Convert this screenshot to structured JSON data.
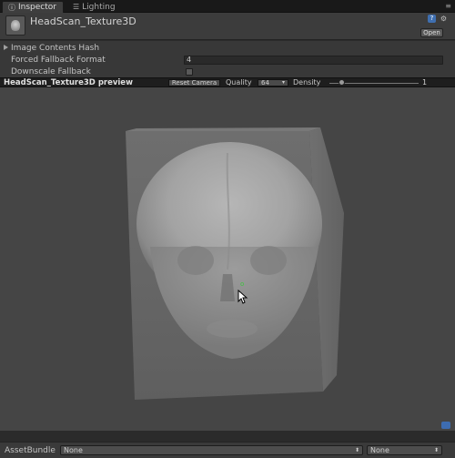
{
  "tabs": [
    {
      "label": "Inspector",
      "icon": "info-icon"
    },
    {
      "label": "Lighting",
      "icon": "lighting-icon"
    }
  ],
  "header": {
    "title": "HeadScan_Texture3D",
    "open_label": "Open"
  },
  "properties": [
    {
      "label": "Image Contents Hash",
      "type": "foldout"
    },
    {
      "label": "Forced Fallback Format",
      "value": "4"
    },
    {
      "label": "Downscale Fallback",
      "checked": false
    }
  ],
  "preview": {
    "title": "HeadScan_Texture3D preview",
    "reset_camera_label": "Reset Camera",
    "quality_label": "Quality",
    "quality_value": "64",
    "density_label": "Density",
    "density_value": "1",
    "gizmo_label": "o"
  },
  "footer": {
    "assetbundle_label": "AssetBundle",
    "bundle_name": "None",
    "variant_name": "None"
  },
  "colors": {
    "background": "#454545",
    "accent": "#3d6cb0",
    "gizmo": "#3ec43e"
  }
}
